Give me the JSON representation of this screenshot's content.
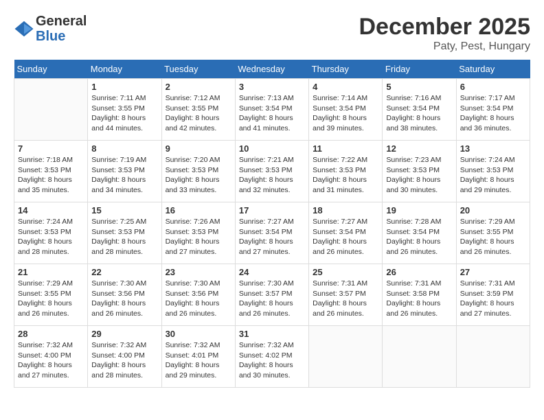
{
  "logo": {
    "line1": "General",
    "line2": "Blue"
  },
  "title": "December 2025",
  "location": "Paty, Pest, Hungary",
  "weekdays": [
    "Sunday",
    "Monday",
    "Tuesday",
    "Wednesday",
    "Thursday",
    "Friday",
    "Saturday"
  ],
  "weeks": [
    [
      {
        "day": "",
        "info": ""
      },
      {
        "day": "1",
        "info": "Sunrise: 7:11 AM\nSunset: 3:55 PM\nDaylight: 8 hours\nand 44 minutes."
      },
      {
        "day": "2",
        "info": "Sunrise: 7:12 AM\nSunset: 3:55 PM\nDaylight: 8 hours\nand 42 minutes."
      },
      {
        "day": "3",
        "info": "Sunrise: 7:13 AM\nSunset: 3:54 PM\nDaylight: 8 hours\nand 41 minutes."
      },
      {
        "day": "4",
        "info": "Sunrise: 7:14 AM\nSunset: 3:54 PM\nDaylight: 8 hours\nand 39 minutes."
      },
      {
        "day": "5",
        "info": "Sunrise: 7:16 AM\nSunset: 3:54 PM\nDaylight: 8 hours\nand 38 minutes."
      },
      {
        "day": "6",
        "info": "Sunrise: 7:17 AM\nSunset: 3:54 PM\nDaylight: 8 hours\nand 36 minutes."
      }
    ],
    [
      {
        "day": "7",
        "info": "Sunrise: 7:18 AM\nSunset: 3:53 PM\nDaylight: 8 hours\nand 35 minutes."
      },
      {
        "day": "8",
        "info": "Sunrise: 7:19 AM\nSunset: 3:53 PM\nDaylight: 8 hours\nand 34 minutes."
      },
      {
        "day": "9",
        "info": "Sunrise: 7:20 AM\nSunset: 3:53 PM\nDaylight: 8 hours\nand 33 minutes."
      },
      {
        "day": "10",
        "info": "Sunrise: 7:21 AM\nSunset: 3:53 PM\nDaylight: 8 hours\nand 32 minutes."
      },
      {
        "day": "11",
        "info": "Sunrise: 7:22 AM\nSunset: 3:53 PM\nDaylight: 8 hours\nand 31 minutes."
      },
      {
        "day": "12",
        "info": "Sunrise: 7:23 AM\nSunset: 3:53 PM\nDaylight: 8 hours\nand 30 minutes."
      },
      {
        "day": "13",
        "info": "Sunrise: 7:24 AM\nSunset: 3:53 PM\nDaylight: 8 hours\nand 29 minutes."
      }
    ],
    [
      {
        "day": "14",
        "info": "Sunrise: 7:24 AM\nSunset: 3:53 PM\nDaylight: 8 hours\nand 28 minutes."
      },
      {
        "day": "15",
        "info": "Sunrise: 7:25 AM\nSunset: 3:53 PM\nDaylight: 8 hours\nand 28 minutes."
      },
      {
        "day": "16",
        "info": "Sunrise: 7:26 AM\nSunset: 3:53 PM\nDaylight: 8 hours\nand 27 minutes."
      },
      {
        "day": "17",
        "info": "Sunrise: 7:27 AM\nSunset: 3:54 PM\nDaylight: 8 hours\nand 27 minutes."
      },
      {
        "day": "18",
        "info": "Sunrise: 7:27 AM\nSunset: 3:54 PM\nDaylight: 8 hours\nand 26 minutes."
      },
      {
        "day": "19",
        "info": "Sunrise: 7:28 AM\nSunset: 3:54 PM\nDaylight: 8 hours\nand 26 minutes."
      },
      {
        "day": "20",
        "info": "Sunrise: 7:29 AM\nSunset: 3:55 PM\nDaylight: 8 hours\nand 26 minutes."
      }
    ],
    [
      {
        "day": "21",
        "info": "Sunrise: 7:29 AM\nSunset: 3:55 PM\nDaylight: 8 hours\nand 26 minutes."
      },
      {
        "day": "22",
        "info": "Sunrise: 7:30 AM\nSunset: 3:56 PM\nDaylight: 8 hours\nand 26 minutes."
      },
      {
        "day": "23",
        "info": "Sunrise: 7:30 AM\nSunset: 3:56 PM\nDaylight: 8 hours\nand 26 minutes."
      },
      {
        "day": "24",
        "info": "Sunrise: 7:30 AM\nSunset: 3:57 PM\nDaylight: 8 hours\nand 26 minutes."
      },
      {
        "day": "25",
        "info": "Sunrise: 7:31 AM\nSunset: 3:57 PM\nDaylight: 8 hours\nand 26 minutes."
      },
      {
        "day": "26",
        "info": "Sunrise: 7:31 AM\nSunset: 3:58 PM\nDaylight: 8 hours\nand 26 minutes."
      },
      {
        "day": "27",
        "info": "Sunrise: 7:31 AM\nSunset: 3:59 PM\nDaylight: 8 hours\nand 27 minutes."
      }
    ],
    [
      {
        "day": "28",
        "info": "Sunrise: 7:32 AM\nSunset: 4:00 PM\nDaylight: 8 hours\nand 27 minutes."
      },
      {
        "day": "29",
        "info": "Sunrise: 7:32 AM\nSunset: 4:00 PM\nDaylight: 8 hours\nand 28 minutes."
      },
      {
        "day": "30",
        "info": "Sunrise: 7:32 AM\nSunset: 4:01 PM\nDaylight: 8 hours\nand 29 minutes."
      },
      {
        "day": "31",
        "info": "Sunrise: 7:32 AM\nSunset: 4:02 PM\nDaylight: 8 hours\nand 30 minutes."
      },
      {
        "day": "",
        "info": ""
      },
      {
        "day": "",
        "info": ""
      },
      {
        "day": "",
        "info": ""
      }
    ]
  ]
}
